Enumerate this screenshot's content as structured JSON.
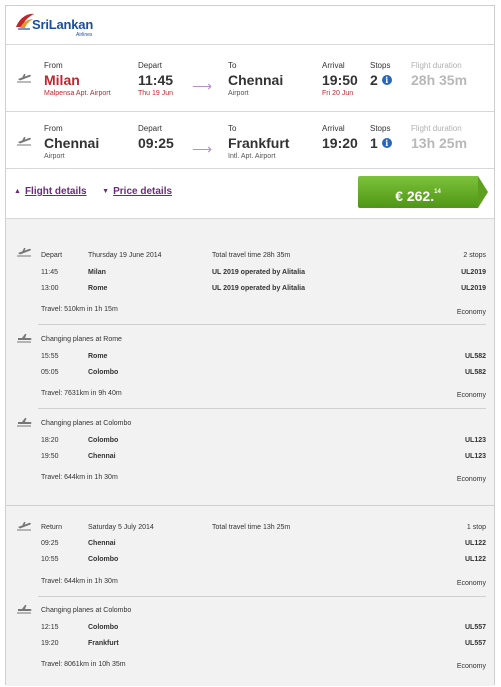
{
  "brand": {
    "name": "SriLankan",
    "sub": "Airlines"
  },
  "legs": [
    {
      "from_label": "From",
      "from_city": "Milan",
      "from_airport": "Malpensa Apt. Airport",
      "depart_label": "Depart",
      "depart_time": "11:45",
      "depart_date": "Thu 19 Jun",
      "to_label": "To",
      "to_city": "Chennai",
      "to_airport": "Airport",
      "arrival_label": "Arrival",
      "arrival_time": "19:50",
      "arrival_date": "Fri 20 Jun",
      "stops_label": "Stops",
      "stops": "2",
      "duration_label": "Flight duration",
      "duration": "28h 35m"
    },
    {
      "from_label": "From",
      "from_city": "Chennai",
      "from_airport": "Airport",
      "depart_label": "Depart",
      "depart_time": "09:25",
      "depart_date": "",
      "to_label": "To",
      "to_city": "Frankfurt",
      "to_airport": "Intl. Apt. Airport",
      "arrival_label": "Arrival",
      "arrival_time": "19:20",
      "arrival_date": "",
      "stops_label": "Stops",
      "stops": "1",
      "duration_label": "Flight duration",
      "duration": "13h 25m"
    }
  ],
  "links": {
    "flight_details": "Flight details",
    "price_details": "Price details"
  },
  "price": {
    "main": "€ 262.",
    "cents": "14"
  },
  "outbound": {
    "label": "Depart",
    "date": "Thursday 19 June 2014",
    "total": "Total travel time 28h 35m",
    "stops": "2 stops",
    "segments": [
      {
        "rows": [
          {
            "time": "11:45",
            "city": "Milan",
            "operated": "UL 2019 operated by Alitalia",
            "flight": "UL2019"
          },
          {
            "time": "13:00",
            "city": "Rome",
            "operated": "UL 2019 operated by Alitalia",
            "flight": "UL2019"
          }
        ],
        "travel": "Travel: 510km in 1h 15m",
        "cabin": "Economy"
      },
      {
        "change": "Changing planes at Rome",
        "rows": [
          {
            "time": "15:55",
            "city": "Rome",
            "operated": "",
            "flight": "UL582"
          },
          {
            "time": "05:05",
            "city": "Colombo",
            "operated": "",
            "flight": "UL582"
          }
        ],
        "travel": "Travel: 7631km in 9h 40m",
        "cabin": "Economy"
      },
      {
        "change": "Changing planes at Colombo",
        "rows": [
          {
            "time": "18:20",
            "city": "Colombo",
            "operated": "",
            "flight": "UL123"
          },
          {
            "time": "19:50",
            "city": "Chennai",
            "operated": "",
            "flight": "UL123"
          }
        ],
        "travel": "Travel: 644km in 1h 30m",
        "cabin": "Economy"
      }
    ]
  },
  "return": {
    "label": "Return",
    "date": "Saturday 5 July 2014",
    "total": "Total travel time 13h 25m",
    "stops": "1 stop",
    "segments": [
      {
        "rows": [
          {
            "time": "09:25",
            "city": "Chennai",
            "operated": "",
            "flight": "UL122"
          },
          {
            "time": "10:55",
            "city": "Colombo",
            "operated": "",
            "flight": "UL122"
          }
        ],
        "travel": "Travel: 644km in 1h 30m",
        "cabin": "Economy"
      },
      {
        "change": "Changing planes at Colombo",
        "rows": [
          {
            "time": "12:15",
            "city": "Colombo",
            "operated": "",
            "flight": "UL557"
          },
          {
            "time": "19:20",
            "city": "Frankfurt",
            "operated": "",
            "flight": "UL557"
          }
        ],
        "travel": "Travel: 8061km in 10h 35m",
        "cabin": "Economy"
      }
    ]
  },
  "colors": {
    "accent_red": "#c0272d",
    "link_purple": "#6a2a7a",
    "price_green": "#5aa01e",
    "brand_blue": "#1a4f9c"
  }
}
